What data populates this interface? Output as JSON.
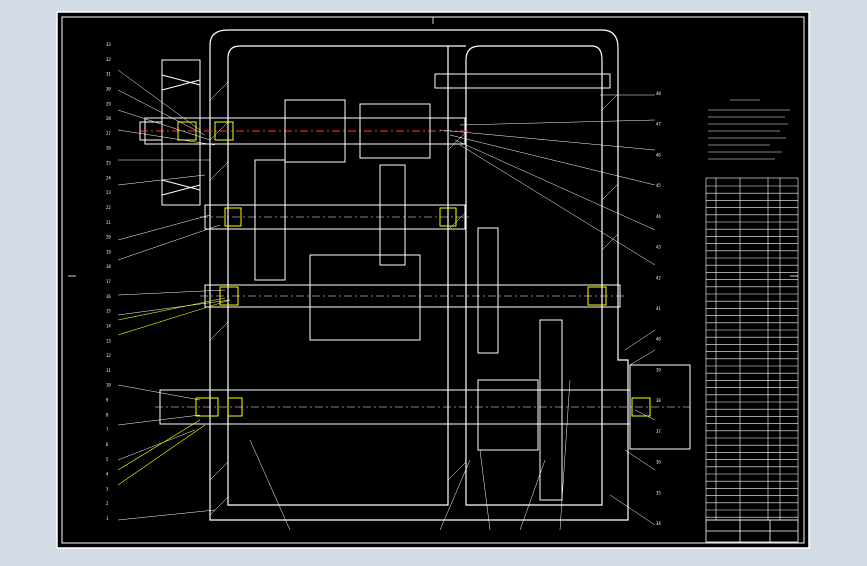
{
  "drawing": {
    "background_color": "#000000",
    "frame_color": "#ffffff",
    "viewport_bg": "#d3dbe6",
    "title_block": {
      "drawing_title": "",
      "notes_heading": "",
      "notes": []
    },
    "parts_list": {
      "rows": []
    },
    "balloon_labels_left": [
      "33",
      "32",
      "31",
      "30",
      "29",
      "28",
      "27",
      "26",
      "25",
      "24",
      "23",
      "22",
      "21",
      "20",
      "19",
      "18",
      "17",
      "16",
      "15",
      "14",
      "13",
      "12",
      "11",
      "10",
      "9",
      "8",
      "7",
      "6",
      "5",
      "4",
      "3",
      "2",
      "1"
    ],
    "balloon_labels_right": [
      "48",
      "47",
      "46",
      "45",
      "44",
      "43",
      "42",
      "41",
      "40",
      "39",
      "38",
      "37",
      "36",
      "35",
      "34"
    ]
  }
}
